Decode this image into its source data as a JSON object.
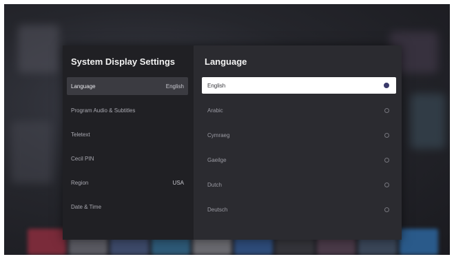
{
  "settings": {
    "title": "System Display Settings",
    "items": [
      {
        "label": "Language",
        "value": "English"
      },
      {
        "label": "Program Audio & Subtitles",
        "value": ""
      },
      {
        "label": "Teletext",
        "value": ""
      },
      {
        "label": "Cecil PIN",
        "value": ""
      },
      {
        "label": "Region",
        "value": "USA"
      },
      {
        "label": "Date & Time",
        "value": ""
      }
    ]
  },
  "language_panel": {
    "title": "Language",
    "options": [
      {
        "label": "English",
        "selected": true
      },
      {
        "label": "Arabic",
        "selected": false
      },
      {
        "label": "Cymraeg",
        "selected": false
      },
      {
        "label": "Gaeilge",
        "selected": false
      },
      {
        "label": "Dutch",
        "selected": false
      },
      {
        "label": "Deutsch",
        "selected": false
      }
    ]
  },
  "colors": {
    "selected_bg": "#ffffff",
    "panel_left_bg": "#202024",
    "panel_right_bg": "#2b2b30",
    "radio_selected": "#3a3a6a"
  }
}
